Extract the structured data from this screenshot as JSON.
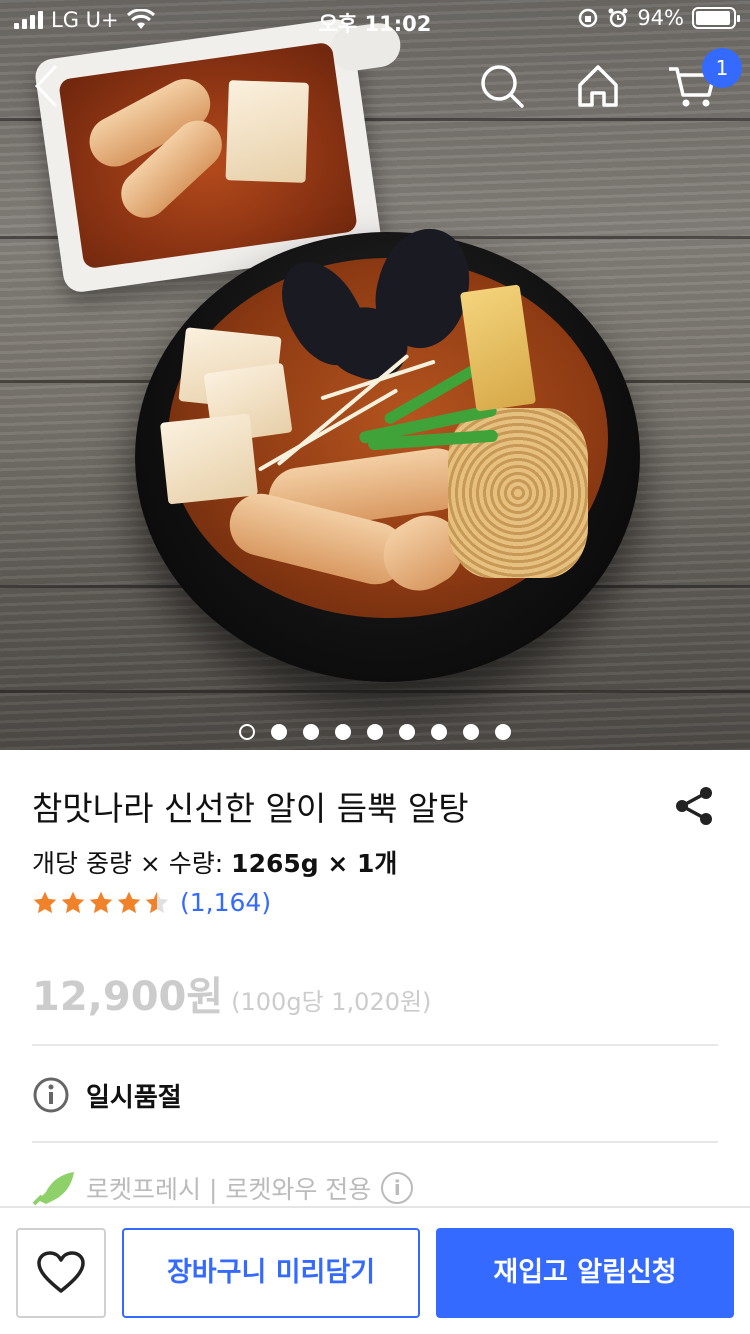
{
  "status_bar": {
    "carrier": "LG U+",
    "time": "오후 11:02",
    "battery": "94%",
    "battery_level": 0.94
  },
  "nav": {
    "cart_count": "1",
    "icons": [
      "back-icon",
      "search-icon",
      "home-icon",
      "cart-icon"
    ]
  },
  "gallery": {
    "image_count": 9,
    "active_index": 0
  },
  "product": {
    "title": "참맛나라 신선한 알이 듬뿍 알탕",
    "weight_label": "개당 중량 × 수량:",
    "weight_value": "1265g × 1개",
    "rating_stars": 4.5,
    "review_count": "(1,164)",
    "price": "12,900원",
    "unit_price": "(100g당 1,020원)",
    "stock_status": "일시품절",
    "delivery": "로켓프레시 | 로켓와우 전용"
  },
  "actions": {
    "precart_label": "장바구니 미리담기",
    "notify_label": "재입고 알림신청"
  },
  "colors": {
    "accent": "#346aff",
    "star": "#f2822a",
    "rocket_green": "#8ed16b"
  }
}
